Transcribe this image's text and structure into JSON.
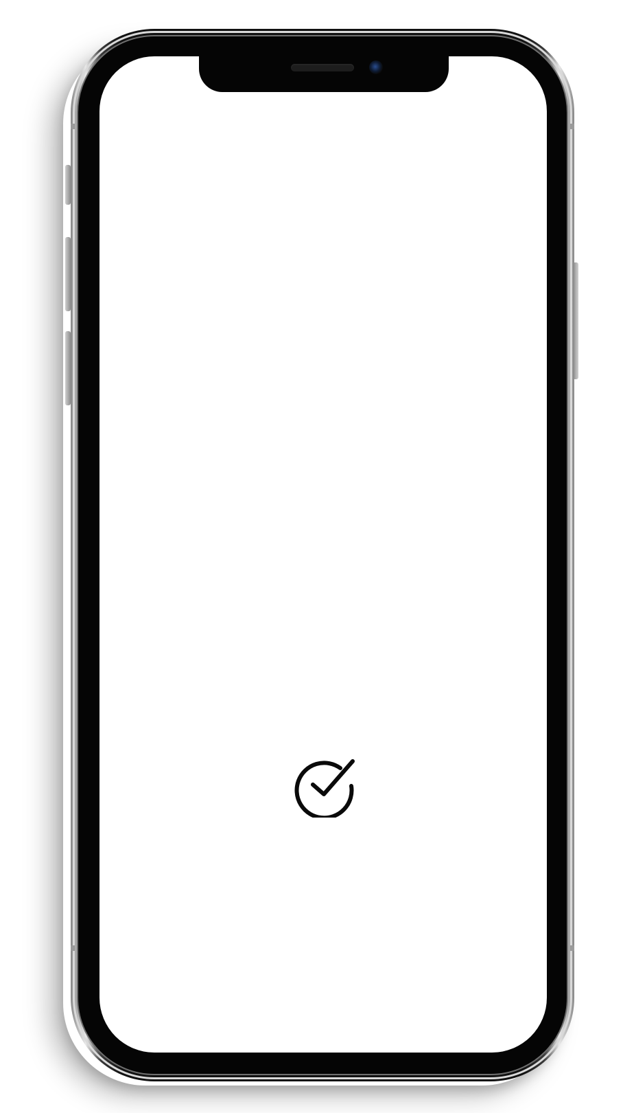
{
  "device": {
    "model": "phone-mockup",
    "frame_color": "#111111",
    "screen_color": "#ffffff"
  },
  "screen": {
    "status_icon": "check-circle-icon",
    "icon_color": "#0a0a0a"
  }
}
